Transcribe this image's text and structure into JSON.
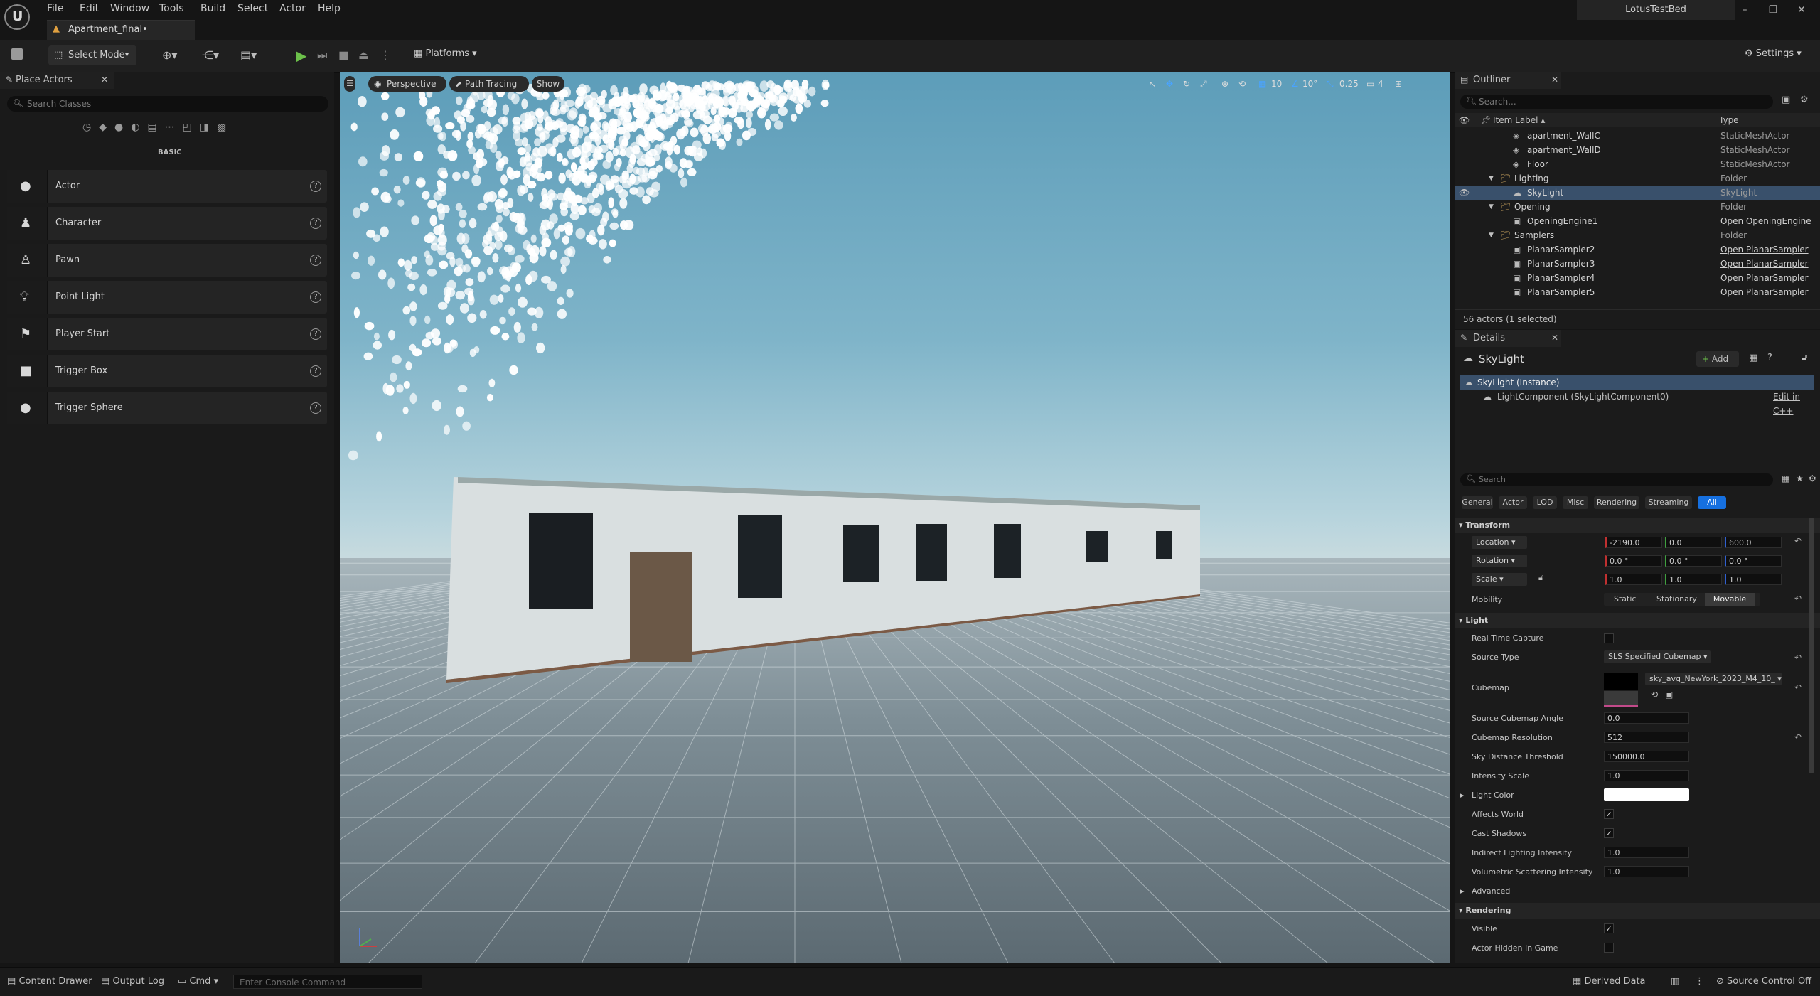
{
  "menu": {
    "items": [
      "File",
      "Edit",
      "Window",
      "Tools",
      "Build",
      "Select",
      "Actor",
      "Help"
    ]
  },
  "document_tab": {
    "label": "Apartment_final•"
  },
  "project_name": "LotusTestBed",
  "toolbar": {
    "select_mode": "Select Mode",
    "platforms": "Platforms",
    "settings": "Settings"
  },
  "place_actors": {
    "title": "Place Actors",
    "search_placeholder": "Search Classes",
    "category_label": "BASIC",
    "items": [
      {
        "label": "Actor",
        "icon": "sphere-icon"
      },
      {
        "label": "Character",
        "icon": "character-icon"
      },
      {
        "label": "Pawn",
        "icon": "pawn-icon"
      },
      {
        "label": "Point Light",
        "icon": "bulb-icon"
      },
      {
        "label": "Player Start",
        "icon": "flag-icon"
      },
      {
        "label": "Trigger Box",
        "icon": "cube-icon"
      },
      {
        "label": "Trigger Sphere",
        "icon": "sphere-icon"
      }
    ]
  },
  "viewport": {
    "perspective": "Perspective",
    "path_tracing": "Path Tracing",
    "show": "Show",
    "grid_snap": "10",
    "rotation_snap": "10°",
    "scale_snap": "0.25",
    "camera_speed": "4"
  },
  "outliner": {
    "title": "Outliner",
    "search_placeholder": "Search...",
    "col_label": "Item Label ▴",
    "col_type": "Type",
    "rows": [
      {
        "label": "apartment_WallC",
        "type": "StaticMeshActor",
        "indent": 3,
        "kind": "mesh"
      },
      {
        "label": "apartment_WallD",
        "type": "StaticMeshActor",
        "indent": 3,
        "kind": "mesh"
      },
      {
        "label": "Floor",
        "type": "StaticMeshActor",
        "indent": 3,
        "kind": "mesh"
      },
      {
        "label": "Lighting",
        "type": "Folder",
        "indent": 2,
        "kind": "folder"
      },
      {
        "label": "SkyLight",
        "type": "SkyLight",
        "indent": 3,
        "kind": "light",
        "selected": true
      },
      {
        "label": "Opening",
        "type": "Folder",
        "indent": 2,
        "kind": "folder"
      },
      {
        "label": "OpeningEngine1",
        "type": "Open OpeningEngine",
        "indent": 3,
        "kind": "actor",
        "link": true
      },
      {
        "label": "Samplers",
        "type": "Folder",
        "indent": 2,
        "kind": "folder"
      },
      {
        "label": "PlanarSampler2",
        "type": "Open PlanarSampler",
        "indent": 3,
        "kind": "actor",
        "link": true
      },
      {
        "label": "PlanarSampler3",
        "type": "Open PlanarSampler",
        "indent": 3,
        "kind": "actor",
        "link": true
      },
      {
        "label": "PlanarSampler4",
        "type": "Open PlanarSampler",
        "indent": 3,
        "kind": "actor",
        "link": true
      },
      {
        "label": "PlanarSampler5",
        "type": "Open PlanarSampler",
        "indent": 3,
        "kind": "actor",
        "link": true
      }
    ],
    "status": "56 actors (1 selected)"
  },
  "details": {
    "title": "Details",
    "actor_name": "SkyLight",
    "add_label": "Add",
    "instance_label": "SkyLight (Instance)",
    "component_label": "LightComponent (SkyLightComponent0)",
    "edit_cpp": "Edit in C++",
    "search_placeholder": "Search",
    "filter_tabs": [
      "General",
      "Actor",
      "LOD",
      "Misc",
      "Rendering",
      "Streaming",
      "All"
    ],
    "transform": {
      "section": "Transform",
      "location_label": "Location",
      "location": [
        "-2190.0",
        "0.0",
        "600.0"
      ],
      "rotation_label": "Rotation",
      "rotation": [
        "0.0 °",
        "0.0 °",
        "0.0 °"
      ],
      "scale_label": "Scale",
      "scale": [
        "1.0",
        "1.0",
        "1.0"
      ],
      "mobility_label": "Mobility",
      "mobility_options": [
        "Static",
        "Stationary",
        "Movable"
      ]
    },
    "light": {
      "section": "Light",
      "real_time_capture": "Real Time Capture",
      "source_type_label": "Source Type",
      "source_type_value": "SLS Specified Cubemap",
      "cubemap_label": "Cubemap",
      "cubemap_value": "sky_avg_NewYork_2023_M4_10_",
      "source_cubemap_angle_label": "Source Cubemap Angle",
      "source_cubemap_angle": "0.0",
      "cubemap_resolution_label": "Cubemap Resolution",
      "cubemap_resolution": "512",
      "sky_distance_label": "Sky Distance Threshold",
      "sky_distance": "150000.0",
      "intensity_scale_label": "Intensity Scale",
      "intensity_scale": "1.0",
      "light_color_label": "Light Color",
      "affects_world_label": "Affects World",
      "cast_shadows_label": "Cast Shadows",
      "indirect_label": "Indirect Lighting Intensity",
      "indirect": "1.0",
      "volumetric_label": "Volumetric Scattering Intensity",
      "volumetric": "1.0",
      "advanced_label": "Advanced"
    },
    "rendering": {
      "section": "Rendering",
      "visible_label": "Visible",
      "hidden_label": "Actor Hidden In Game"
    }
  },
  "statusbar": {
    "content_drawer": "Content Drawer",
    "output_log": "Output Log",
    "cmd": "Cmd",
    "console_placeholder": "Enter Console Command",
    "derived_data": "Derived Data",
    "source_control": "Source Control Off"
  }
}
